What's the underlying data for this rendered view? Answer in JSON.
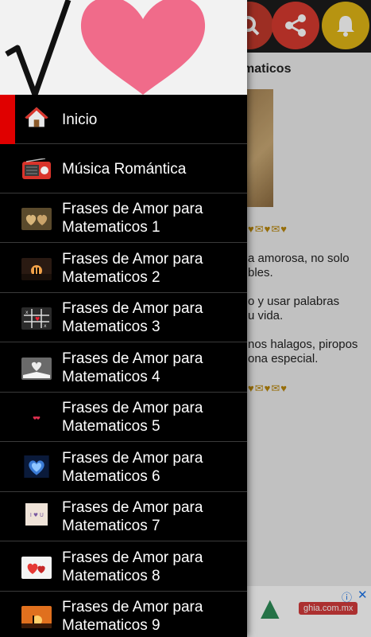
{
  "background": {
    "title": "maticos",
    "text_lines": [
      "a amorosa, no solo",
      "bles.",
      "o y usar palabras",
      "u vida.",
      "nos halagos, piropos",
      "ona especial."
    ],
    "ad": {
      "domain": "ghia.com.mx"
    }
  },
  "drawer": {
    "items": [
      {
        "label": "Inicio",
        "icon": "home-icon"
      },
      {
        "label": "Música Romántica",
        "icon": "radio-icon"
      },
      {
        "label_line1": "Frases de Amor para",
        "label_line2": "Matematicos 1"
      },
      {
        "label_line1": "Frases de Amor para",
        "label_line2": "Matematicos 2"
      },
      {
        "label_line1": "Frases de Amor para",
        "label_line2": "Matematicos 3"
      },
      {
        "label_line1": "Frases de Amor para",
        "label_line2": "Matematicos 4"
      },
      {
        "label_line1": "Frases de Amor para",
        "label_line2": "Matematicos 5"
      },
      {
        "label_line1": "Frases de Amor para",
        "label_line2": "Matematicos 6"
      },
      {
        "label_line1": "Frases de Amor para",
        "label_line2": "Matematicos 7"
      },
      {
        "label_line1": "Frases de Amor para",
        "label_line2": "Matematicos 8"
      },
      {
        "label_line1": "Frases de Amor para",
        "label_line2": "Matematicos 9"
      }
    ]
  },
  "colors": {
    "accent": "#e00000",
    "heart": "#f06b8a",
    "drawer_bg": "#000000"
  }
}
